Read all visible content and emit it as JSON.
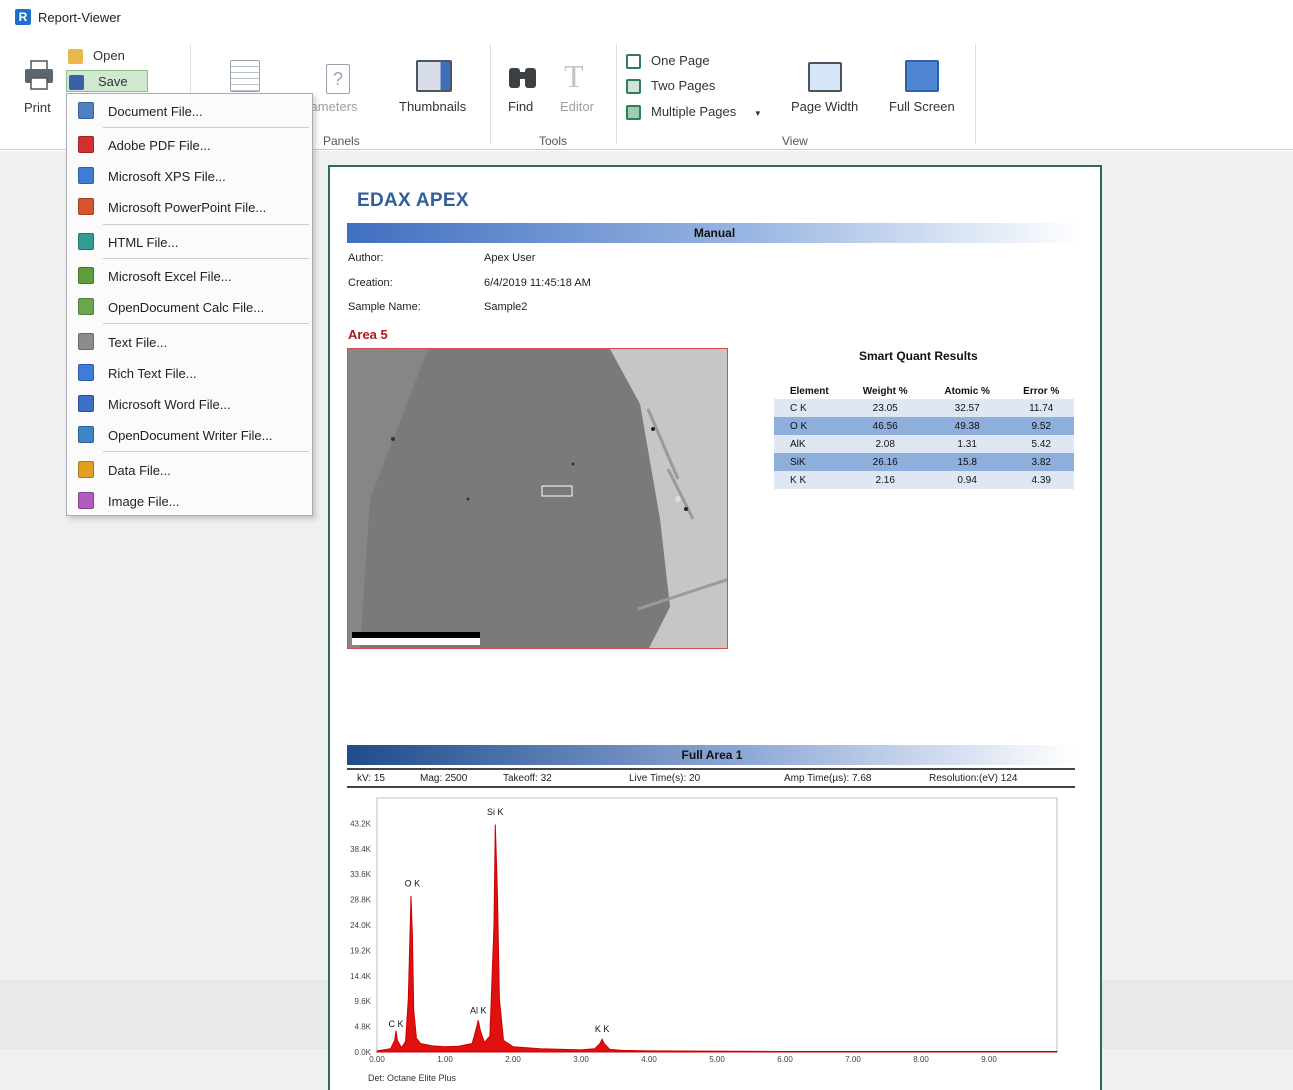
{
  "window": {
    "title": "Report-Viewer"
  },
  "ribbon": {
    "print": "Print",
    "open": "Open",
    "save": "Save",
    "parameters": "arameters",
    "thumbnails": "Thumbnails",
    "panels_group": "Panels",
    "find": "Find",
    "editor": "Editor",
    "tools_group": "Tools",
    "one_page": "One Page",
    "two_pages": "Two Pages",
    "multiple_pages": "Multiple Pages",
    "page_width": "Page Width",
    "full_screen": "Full Screen",
    "view_group": "View"
  },
  "save_menu": {
    "items": [
      {
        "label": "Document File...",
        "color": "#4f7fc4"
      },
      {
        "label": "Adobe PDF File...",
        "color": "#d32f2f"
      },
      {
        "label": "Microsoft XPS File...",
        "color": "#3b7dd8"
      },
      {
        "label": "Microsoft PowerPoint File...",
        "color": "#d9532c"
      },
      {
        "label": "HTML File...",
        "color": "#2f9d8f"
      },
      {
        "label": "Microsoft Excel File...",
        "color": "#5c9f3a"
      },
      {
        "label": "OpenDocument Calc File...",
        "color": "#6aa84f"
      },
      {
        "label": "Text File...",
        "color": "#8c8c8c"
      },
      {
        "label": "Rich Text File...",
        "color": "#3b7dd8"
      },
      {
        "label": "Microsoft Word File...",
        "color": "#3b6fc4"
      },
      {
        "label": "OpenDocument Writer File...",
        "color": "#3d85c6"
      },
      {
        "label": "Data File...",
        "color": "#e0a020"
      },
      {
        "label": "Image File...",
        "color": "#b05cc0"
      }
    ]
  },
  "report": {
    "title": "EDAX APEX",
    "band_manual": "Manual",
    "author_label": "Author:",
    "author": "Apex User",
    "creation_label": "Creation:",
    "creation": "6/4/2019 11:45:18 AM",
    "sample_label": "Sample Name:",
    "sample": "Sample2",
    "area_title": "Area 5",
    "quant_title": "Smart Quant Results",
    "quant_headers": [
      "Element",
      "Weight %",
      "Atomic %",
      "Error %"
    ],
    "quant_rows": [
      [
        "C K",
        "23.05",
        "32.57",
        "11.74"
      ],
      [
        "O K",
        "46.56",
        "49.38",
        "9.52"
      ],
      [
        "AlK",
        "2.08",
        "1.31",
        "5.42"
      ],
      [
        "SiK",
        "26.16",
        "15.8",
        "3.82"
      ],
      [
        "K K",
        "2.16",
        "0.94",
        "4.39"
      ]
    ],
    "band_full": "Full Area 1",
    "params": {
      "kv": "kV: 15",
      "mag": "Mag: 2500",
      "takeoff": "Takeoff: 32",
      "live": "Live Time(s): 20",
      "amp": "Amp Time(µs): 7.68",
      "res": "Resolution:(eV) 124"
    },
    "detector": "Det: Octane Elite Plus"
  },
  "chart_data": {
    "type": "line",
    "title": "",
    "xlabel": "",
    "ylabel": "",
    "x_ticks": [
      "0.00",
      "1.00",
      "2.00",
      "3.00",
      "4.00",
      "5.00",
      "6.00",
      "7.00",
      "8.00",
      "9.00"
    ],
    "y_ticks": [
      "0.0K",
      "4.8K",
      "9.6K",
      "14.4K",
      "19.2K",
      "24.0K",
      "28.8K",
      "33.6K",
      "38.4K",
      "43.2K"
    ],
    "xlim": [
      0,
      10
    ],
    "ylim": [
      0,
      48
    ],
    "series": [
      {
        "x": [
          0,
          0.2,
          0.26,
          0.28,
          0.3,
          0.36,
          0.42,
          0.46,
          0.5,
          0.52,
          0.54,
          0.58,
          0.64,
          0.8,
          1.0,
          1.2,
          1.4,
          1.46,
          1.49,
          1.52,
          1.58,
          1.66,
          1.72,
          1.74,
          1.77,
          1.8,
          1.86,
          2.0,
          2.4,
          3.0,
          3.2,
          3.28,
          3.31,
          3.34,
          3.42,
          3.6,
          4.0,
          6.0,
          8.0,
          10.0
        ],
        "y": [
          0.2,
          0.6,
          2.2,
          4.0,
          2.2,
          0.8,
          2.0,
          10.0,
          29.5,
          22.0,
          8.0,
          2.6,
          1.6,
          1.2,
          1.0,
          1.1,
          1.6,
          4.5,
          6.0,
          4.0,
          1.8,
          3.0,
          24.0,
          43.0,
          30.0,
          10.0,
          2.2,
          1.0,
          0.6,
          0.4,
          0.6,
          1.6,
          2.4,
          1.6,
          0.5,
          0.3,
          0.2,
          0.1,
          0.1,
          0.1
        ]
      }
    ],
    "peak_labels": [
      {
        "text": "C K",
        "x": 0.28,
        "y": 4.0
      },
      {
        "text": "O K",
        "x": 0.52,
        "y": 30.5
      },
      {
        "text": "Al K",
        "x": 1.49,
        "y": 6.5
      },
      {
        "text": "Si K",
        "x": 1.74,
        "y": 44.0
      },
      {
        "text": "K K",
        "x": 3.31,
        "y": 3.0
      }
    ]
  }
}
